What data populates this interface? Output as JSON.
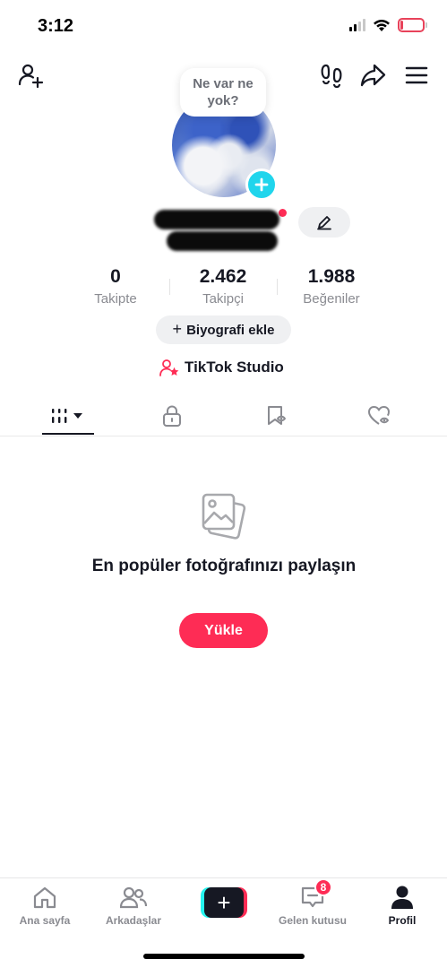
{
  "status_bar": {
    "time": "3:12",
    "battery": "13",
    "battery_level": 0.13,
    "battery_color": "#e8425a"
  },
  "header": {
    "icons": [
      "add-friend-icon",
      "footprints-icon",
      "share-icon",
      "menu-icon"
    ]
  },
  "profile": {
    "note": "Ne var ne yok?",
    "username_redacted": true
  },
  "stats": [
    {
      "value": "0",
      "label": "Takipte"
    },
    {
      "value": "2.462",
      "label": "Takipçi"
    },
    {
      "value": "1.988",
      "label": "Beğeniler"
    }
  ],
  "bio_button": {
    "plus": "+",
    "label": "Biyografi ekle"
  },
  "studio": {
    "label": "TikTok Studio"
  },
  "tabs": [
    {
      "icon": "grid-dropdown-icon",
      "active": true
    },
    {
      "icon": "lock-icon",
      "active": false
    },
    {
      "icon": "bookmark-icon",
      "active": false
    },
    {
      "icon": "liked-hidden-icon",
      "active": false
    }
  ],
  "empty_state": {
    "title": "En popüler fotoğrafınızı paylaşın",
    "button": "Yükle"
  },
  "bottom_nav": {
    "items": [
      {
        "label": "Ana sayfa",
        "icon": "home-icon"
      },
      {
        "label": "Arkadaşlar",
        "icon": "friends-icon"
      },
      {
        "label": "",
        "icon": "create-icon"
      },
      {
        "label": "Gelen kutusu",
        "icon": "inbox-icon",
        "badge": "8"
      },
      {
        "label": "Profil",
        "icon": "profile-icon",
        "active": true
      }
    ]
  },
  "colors": {
    "accent": "#fe2c55",
    "cyan": "#20d5ec",
    "text": "#161823",
    "muted": "#8a8b91"
  }
}
